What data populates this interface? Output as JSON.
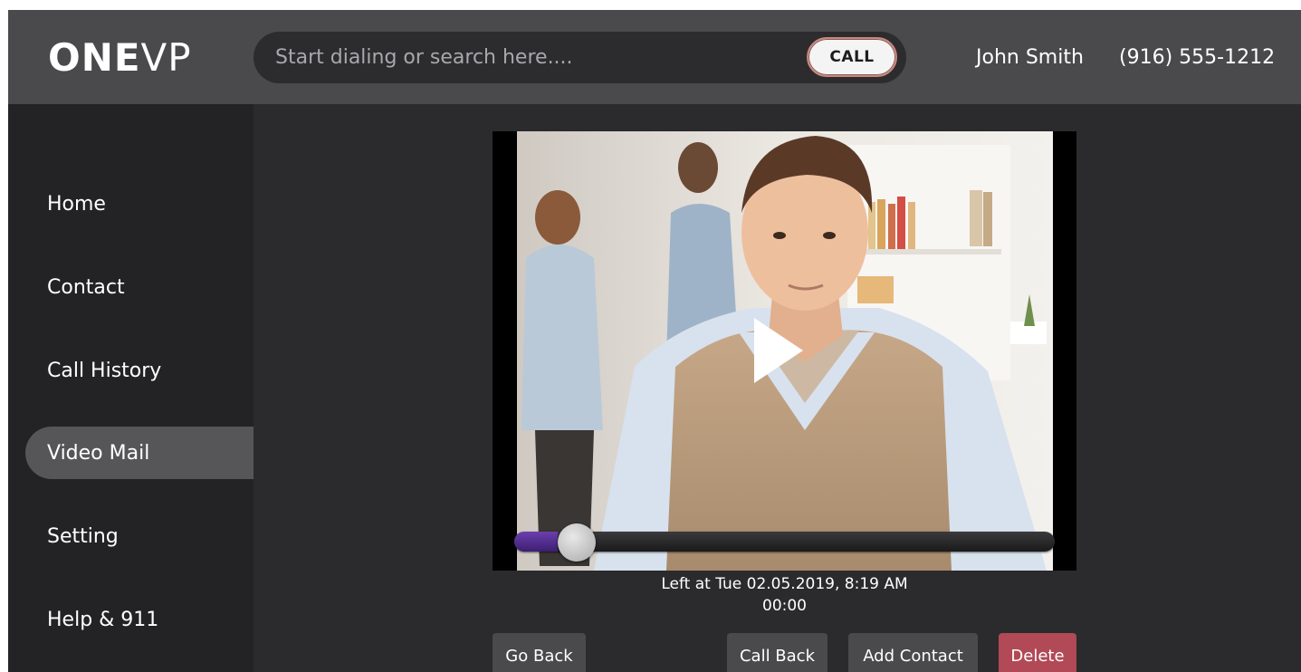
{
  "header": {
    "logo_bold": "ONE",
    "logo_light": "VP",
    "search_placeholder": "Start dialing or search here....",
    "call_label": "CALL",
    "user_name": "John Smith",
    "user_phone": "(916) 555-1212"
  },
  "sidebar": {
    "items": [
      {
        "label": "Home",
        "active": false
      },
      {
        "label": "Contact",
        "active": false
      },
      {
        "label": "Call History",
        "active": false
      },
      {
        "label": "Video Mail",
        "active": true
      },
      {
        "label": "Setting",
        "active": false
      },
      {
        "label": "Help & 911",
        "active": false
      }
    ]
  },
  "video": {
    "left_at": "Left at Tue 02.05.2019, 8:19 AM",
    "elapsed": "00:00",
    "progress": 0.08
  },
  "actions": {
    "go_back": "Go Back",
    "call_back": "Call Back",
    "add_contact": "Add Contact",
    "delete": "Delete"
  },
  "colors": {
    "header_bg": "#4a4a4d",
    "sidebar_bg": "#232325",
    "main_bg": "#2b2b2d",
    "active_nav": "#565659",
    "progress_fill": "#5a2f9c",
    "delete_bg": "#b14a56"
  }
}
